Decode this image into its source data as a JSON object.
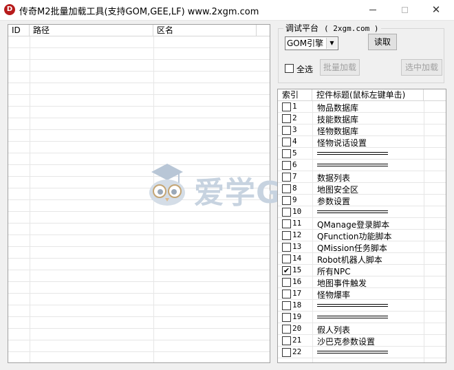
{
  "window": {
    "icon_letter": "D",
    "title": "传奇M2批量加载工具(支持GOM,GEE,LF) www.2xgm.com",
    "close_glyph": "✕"
  },
  "left_list": {
    "columns": [
      "ID",
      "路径",
      "区名"
    ]
  },
  "watermark": {
    "text": "爱学GM"
  },
  "platform": {
    "label": "调试平台",
    "site": "( 2xgm.com )",
    "engine_selected": "GOM引擎",
    "read_button": "读取",
    "select_all_label": "全选",
    "batch_load_button": "批量加载",
    "load_selected_button": "选中加载"
  },
  "right_list": {
    "columns": [
      "索引",
      "控件标题(鼠标左键单击)"
    ],
    "rows": [
      {
        "index": "1",
        "title": "物品数据库",
        "checked": false,
        "separator": false
      },
      {
        "index": "2",
        "title": "技能数据库",
        "checked": false,
        "separator": false
      },
      {
        "index": "3",
        "title": "怪物数据库",
        "checked": false,
        "separator": false
      },
      {
        "index": "4",
        "title": "怪物说话设置",
        "checked": false,
        "separator": false
      },
      {
        "index": "5",
        "title": "",
        "checked": false,
        "separator": true
      },
      {
        "index": "6",
        "title": "",
        "checked": false,
        "separator": true
      },
      {
        "index": "7",
        "title": "数据列表",
        "checked": false,
        "separator": false
      },
      {
        "index": "8",
        "title": "地图安全区",
        "checked": false,
        "separator": false
      },
      {
        "index": "9",
        "title": "参数设置",
        "checked": false,
        "separator": false
      },
      {
        "index": "10",
        "title": "",
        "checked": false,
        "separator": true
      },
      {
        "index": "11",
        "title": "QManage登录脚本",
        "checked": false,
        "separator": false
      },
      {
        "index": "12",
        "title": "QFunction功能脚本",
        "checked": false,
        "separator": false
      },
      {
        "index": "13",
        "title": "QMission任务脚本",
        "checked": false,
        "separator": false
      },
      {
        "index": "14",
        "title": "Robot机器人脚本",
        "checked": false,
        "separator": false
      },
      {
        "index": "15",
        "title": "所有NPC",
        "checked": true,
        "separator": false
      },
      {
        "index": "16",
        "title": "地图事件触发",
        "checked": false,
        "separator": false
      },
      {
        "index": "17",
        "title": "怪物爆率",
        "checked": false,
        "separator": false
      },
      {
        "index": "18",
        "title": "",
        "checked": false,
        "separator": true
      },
      {
        "index": "19",
        "title": "",
        "checked": false,
        "separator": true
      },
      {
        "index": "20",
        "title": "假人列表",
        "checked": false,
        "separator": false
      },
      {
        "index": "21",
        "title": "沙巴克参数设置",
        "checked": false,
        "separator": false
      },
      {
        "index": "22",
        "title": "",
        "checked": false,
        "separator": true
      }
    ]
  }
}
